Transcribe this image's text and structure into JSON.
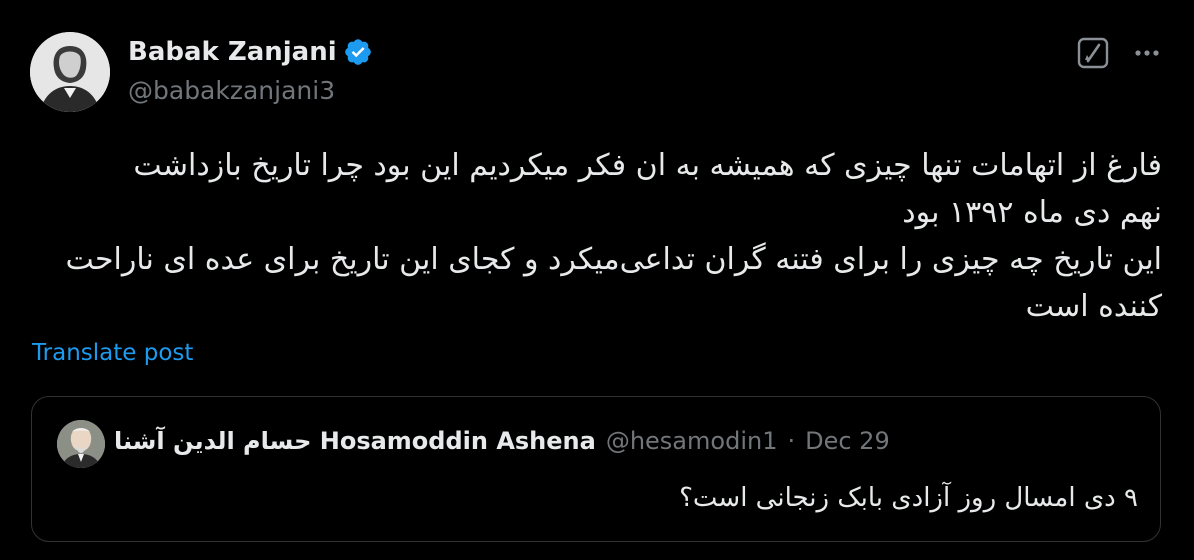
{
  "author": {
    "display_name": "Babak Zanjani",
    "handle": "@babakzanjani3",
    "verified_icon": "verified-badge-icon",
    "avatar": "avatar"
  },
  "header_actions": {
    "grok_icon": "grok-icon",
    "more_icon": "more-icon"
  },
  "post": {
    "lines": [
      "فارغ از اتهامات تنها چیزی که همیشه به ان فکر میکردیم این بود چرا تاریخ بازداشت",
      "نهم دی ماه ۱۳۹۲ بود",
      "این تاریخ چه چیزی را برای فتنه گران تداعی‌میکرد و کجای این تاریخ برای عده ای ناراحت",
      "کننده است"
    ],
    "translate_label": "Translate post"
  },
  "quote": {
    "display_name": "حسام الدین آشنا Hosamoddin Ashena",
    "handle": "@hesamodin1",
    "separator": "·",
    "date": "Dec 29",
    "text": "۹ دی امسال روز آزادی بابک زنجانی است؟"
  },
  "colors": {
    "background": "#000000",
    "text_primary": "#e7e9ea",
    "text_secondary": "#71767b",
    "accent": "#1d9bf0",
    "border": "#2f3336"
  }
}
